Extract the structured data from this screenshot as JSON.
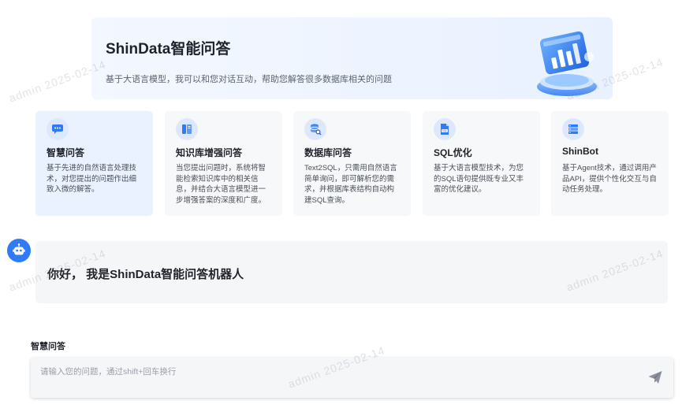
{
  "hero": {
    "title": "ShinData智能问答",
    "description": "基于大语言模型，我可以和您对话互动，帮助您解答很多数据库相关的问题",
    "art_icon": "chart-illustration-icon"
  },
  "cards": [
    {
      "icon": "chat-bubble-icon",
      "title": "智慧问答",
      "description": "基于先进的自然语言处理技术，对您提出的问题作出细致入微的解答。",
      "active": true
    },
    {
      "icon": "book-icon",
      "title": "知识库增强问答",
      "description": "当您提出问题时，系统将智能检索知识库中的相关信息，并结合大语言模型进一步增强答案的深度和广度。",
      "active": false
    },
    {
      "icon": "database-search-icon",
      "title": "数据库问答",
      "description": "Text2SQL，只需用自然语言简单询问，即可解析您的需求，并根据库表结构自动构建SQL查询。",
      "active": false
    },
    {
      "icon": "sql-file-icon",
      "title": "SQL优化",
      "description": "基于大语言模型技术，为您的SQL语句提供既专业又丰富的优化建议。",
      "active": false
    },
    {
      "icon": "server-stack-icon",
      "title": "ShinBot",
      "description": "基于Agent技术，通过调用产品API，提供个性化交互与自动任务处理。",
      "active": false
    }
  ],
  "greeting": {
    "avatar_icon": "robot-icon",
    "text": "你好， 我是ShinData智能问答机器人"
  },
  "input": {
    "label": "智慧问答",
    "value": "",
    "placeholder": "请输入您的问题，通过shift+回车换行",
    "send_icon": "paper-plane-icon"
  },
  "watermark": "admin 2025-02-14",
  "colors": {
    "accent": "#2f7bf6",
    "active_card_bg": "#ebf2ff",
    "card_bg": "#f7f8fa",
    "send_icon": "#8c929b"
  }
}
